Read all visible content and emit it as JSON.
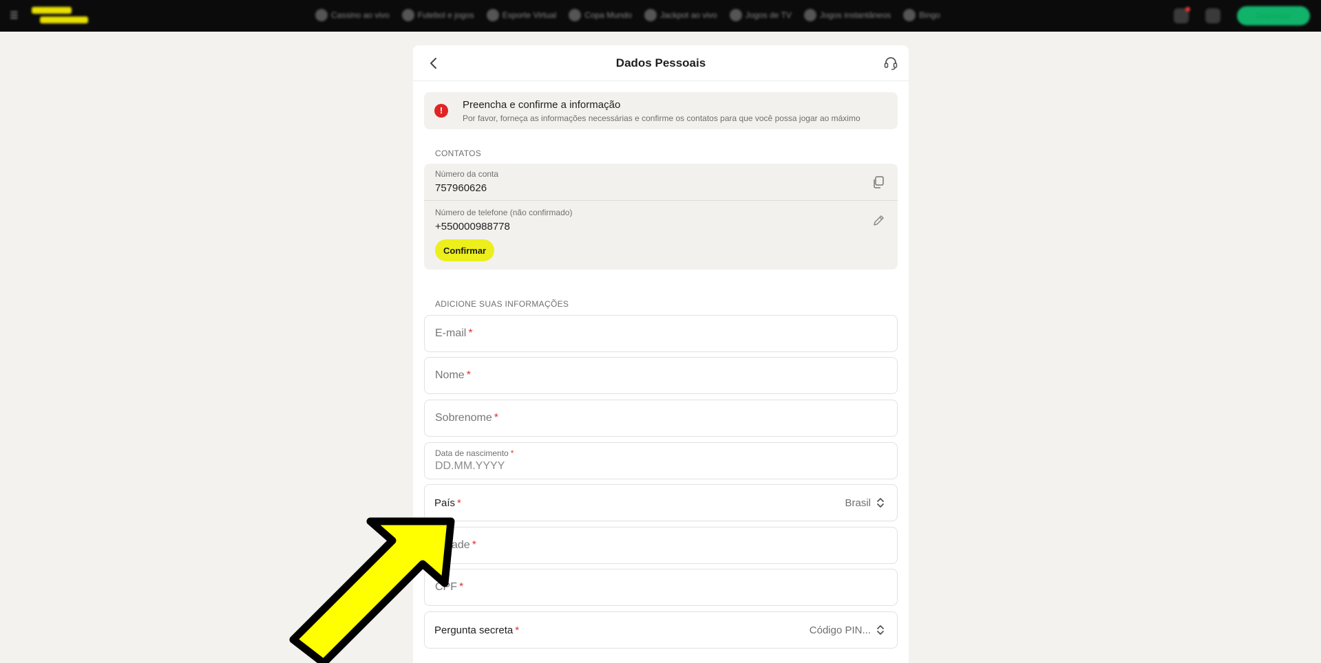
{
  "topbar": {
    "nav_items": [
      "Cassino ao vivo",
      "Futebol e jogos",
      "Esporte Virtual",
      "Copa Mundo",
      "Jackpot ao vivo",
      "Jogos de TV",
      "Jogos instantâneos",
      "Bingo"
    ],
    "deposit_label": "Depositar"
  },
  "header": {
    "title": "Dados Pessoais"
  },
  "notice": {
    "title": "Preencha e confirme a informação",
    "text": "Por favor, forneça as informações necessárias e confirme os contatos para que você possa jogar ao máximo"
  },
  "contacts": {
    "section_label": "CONTATOS",
    "account_label": "Número da conta",
    "account_value": "757960626",
    "phone_label": "Número de telefone (não confirmado)",
    "phone_value": "+550000988778",
    "confirm_label": "Confirmar"
  },
  "form": {
    "section_label": "ADICIONE SUAS INFORMAÇÕES",
    "required_mark": "*",
    "email_placeholder": "E-mail",
    "nome_placeholder": "Nome",
    "sobrenome_placeholder": "Sobrenome",
    "birth_label": "Data de nascimento",
    "birth_placeholder": "DD.MM.YYYY",
    "country_label": "País",
    "country_value": "Brasil",
    "city_placeholder": "Cidade",
    "cpf_placeholder": "CPF",
    "secret_label": "Pergunta secreta",
    "secret_value": "Código PIN..."
  },
  "colors": {
    "accent_yellow": "#ecef1b",
    "arrow_yellow": "#ffff00",
    "error_red": "#e02424",
    "deposit_green": "#11b36b"
  }
}
